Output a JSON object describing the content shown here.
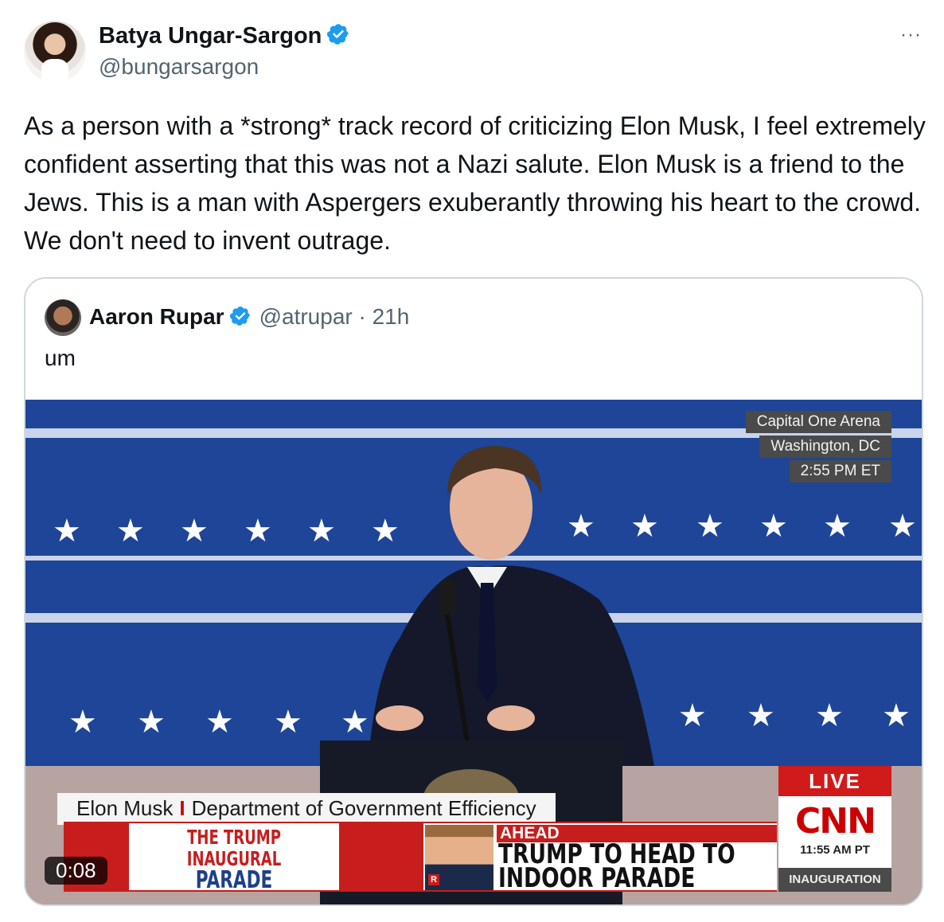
{
  "author": {
    "display_name": "Batya Ungar-Sargon",
    "handle": "@bungarsargon",
    "verified_icon": "verified-badge-icon",
    "more_label": "···"
  },
  "tweet": {
    "text": "As a person with a *strong* track record of criticizing Elon Musk, I feel extremely confident asserting that this was not a Nazi salute. Elon Musk is a friend to the Jews. This is a man with Aspergers exuberantly throwing his heart to the crowd. We don't need to invent outrage."
  },
  "quote": {
    "display_name": "Aaron Rupar",
    "handle": "@atrupar",
    "separator": "·",
    "time": "21h",
    "text": "um",
    "video": {
      "duration": "0:08",
      "overlay": {
        "location_1": "Capital One Arena",
        "location_2": "Washington, DC",
        "location_3": "2:55 PM ET",
        "name": "Elon Musk",
        "name_sep": "I",
        "title": "Department of Government Efficiency",
        "parade_1": "THE TRUMP",
        "parade_2": "INAUGURAL",
        "parade_3": "PARADE",
        "ahead": "AHEAD",
        "headline_1": "TRUMP TO HEAD TO",
        "headline_2": "INDOOR PARADE",
        "r_badge": "R",
        "live": "LIVE",
        "network": "CNN",
        "network_time": "11:55 AM PT",
        "program": "INAUGURATION"
      }
    }
  },
  "colors": {
    "text_primary": "#0f1419",
    "text_secondary": "#536471",
    "verified_blue": "#1d9bf0",
    "card_border": "#cfd9de",
    "cnn_red": "#cc0000"
  }
}
